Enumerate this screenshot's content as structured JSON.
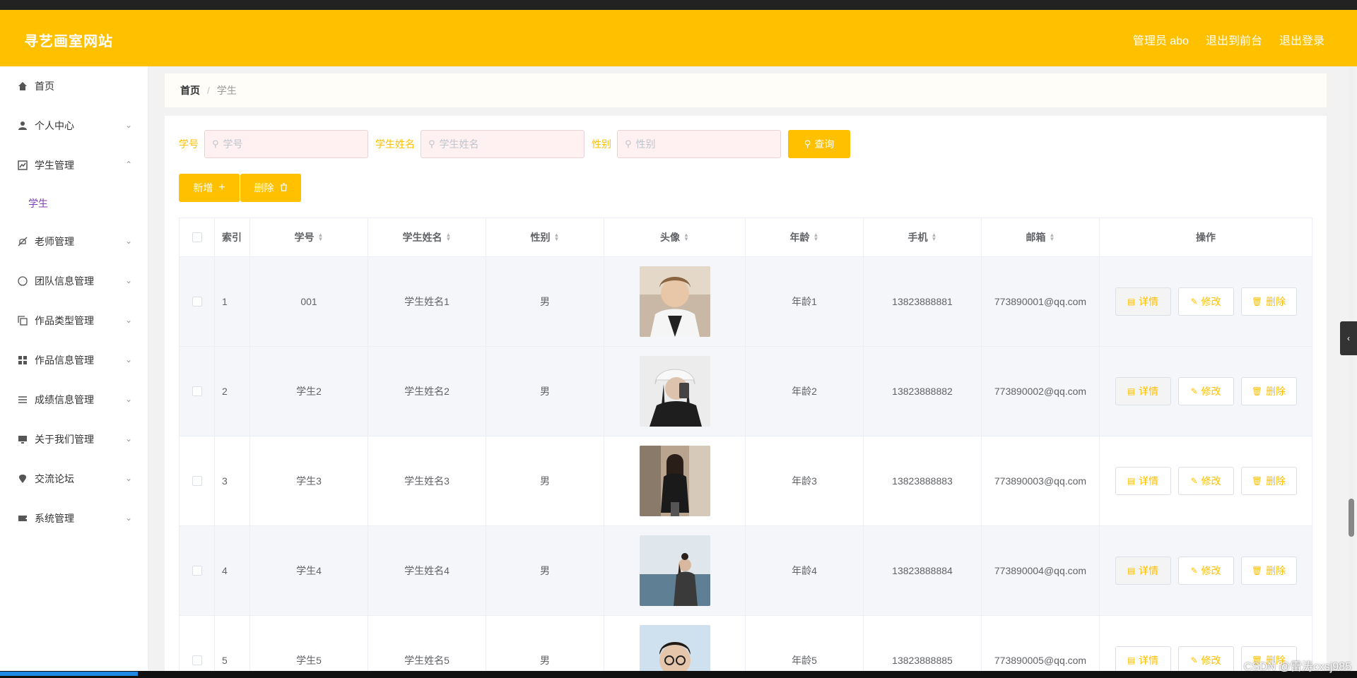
{
  "header": {
    "brand": "寻艺画室网站",
    "nav": [
      "管理员 abo",
      "退出到前台",
      "退出登录"
    ]
  },
  "sidebar": {
    "items": [
      {
        "label": "首页",
        "icon": "home-icon"
      },
      {
        "label": "个人中心",
        "icon": "user-icon"
      },
      {
        "label": "学生管理",
        "icon": "chart-icon",
        "expanded": true,
        "children": [
          "学生"
        ]
      },
      {
        "label": "老师管理",
        "icon": "bell-off-icon"
      },
      {
        "label": "团队信息管理",
        "icon": "compass-icon"
      },
      {
        "label": "作品类型管理",
        "icon": "copy-icon"
      },
      {
        "label": "作品信息管理",
        "icon": "grid-icon"
      },
      {
        "label": "成绩信息管理",
        "icon": "list-icon"
      },
      {
        "label": "关于我们管理",
        "icon": "monitor-icon"
      },
      {
        "label": "交流论坛",
        "icon": "location-icon"
      },
      {
        "label": "系统管理",
        "icon": "ticket-icon"
      }
    ]
  },
  "breadcrumb": {
    "home": "首页",
    "current": "学生"
  },
  "filters": [
    {
      "label": "学号",
      "placeholder": "学号"
    },
    {
      "label": "学生姓名",
      "placeholder": "学生姓名"
    },
    {
      "label": "性别",
      "placeholder": "性别"
    }
  ],
  "buttons": {
    "query": "查询",
    "add": "新增",
    "delete": "删除"
  },
  "table": {
    "columns": [
      "索引",
      "学号",
      "学生姓名",
      "性别",
      "头像",
      "年龄",
      "手机",
      "邮箱",
      "操作"
    ],
    "op_labels": {
      "detail": "详情",
      "edit": "修改",
      "delete": "删除"
    },
    "rows": [
      {
        "idx": "1",
        "sno": "001",
        "name": "学生姓名1",
        "sex": "男",
        "age": "年龄1",
        "tel": "13823888881",
        "mail": "773890001@qq.com"
      },
      {
        "idx": "2",
        "sno": "学生2",
        "name": "学生姓名2",
        "sex": "男",
        "age": "年龄2",
        "tel": "13823888882",
        "mail": "773890002@qq.com"
      },
      {
        "idx": "3",
        "sno": "学生3",
        "name": "学生姓名3",
        "sex": "男",
        "age": "年龄3",
        "tel": "13823888883",
        "mail": "773890003@qq.com"
      },
      {
        "idx": "4",
        "sno": "学生4",
        "name": "学生姓名4",
        "sex": "男",
        "age": "年龄4",
        "tel": "13823888884",
        "mail": "773890004@qq.com"
      },
      {
        "idx": "5",
        "sno": "学生5",
        "name": "学生姓名5",
        "sex": "男",
        "age": "年龄5",
        "tel": "13823888885",
        "mail": "773890005@qq.com"
      }
    ]
  },
  "watermark": "CSDN @雷涛cxsj985",
  "colors": {
    "accent": "#ffc000",
    "submenu_active": "#7e3fb2"
  }
}
